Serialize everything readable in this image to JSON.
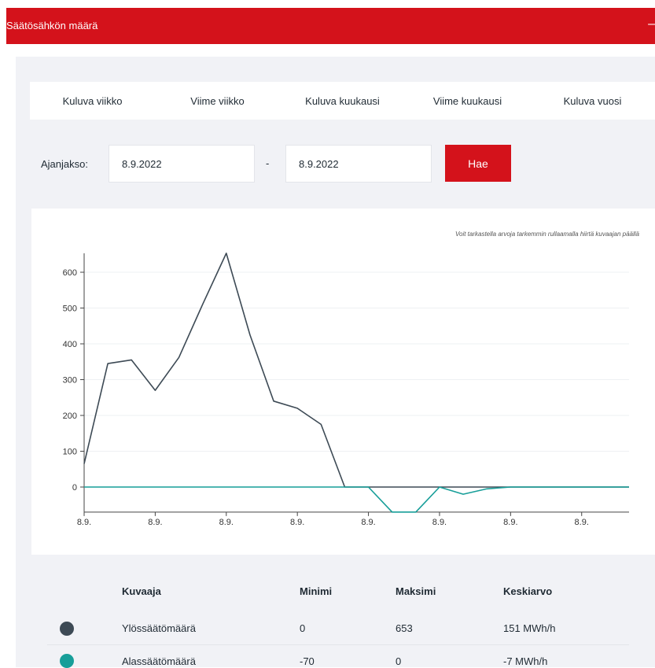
{
  "header": {
    "title": "Säätösähkön määrä",
    "collapse_symbol": "–"
  },
  "tabs": [
    "Kuluva viikko",
    "Viime viikko",
    "Kuluva kuukausi",
    "Viime kuukausi",
    "Kuluva vuosi"
  ],
  "period": {
    "label": "Ajanjakso:",
    "start": "8.9.2022",
    "separator": "-",
    "end": "8.9.2022",
    "search_label": "Hae"
  },
  "chart_hint": "Voit tarkastella arvoja tarkemmin rullaamalla hiirtä kuvaajan päällä",
  "colors": {
    "accent": "#d4121b",
    "up": "#3d4a55",
    "down": "#179e99"
  },
  "chart_data": {
    "type": "line",
    "x_tick_labels": [
      "8.9.",
      "8.9.",
      "8.9.",
      "8.9.",
      "8.9.",
      "8.9.",
      "8.9.",
      "8.9."
    ],
    "y_ticks": [
      0,
      100,
      200,
      300,
      400,
      500,
      600
    ],
    "ylim": [
      -70,
      653
    ],
    "x": [
      0,
      1,
      2,
      3,
      4,
      5,
      6,
      7,
      8,
      9,
      10,
      11,
      12,
      13,
      14,
      15,
      16,
      17,
      18,
      19,
      20,
      21,
      22,
      23
    ],
    "series": [
      {
        "name": "Ylössäätömäärä",
        "color": "#3d4a55",
        "values": [
          65,
          345,
          355,
          270,
          362,
          510,
          653,
          425,
          240,
          220,
          175,
          0,
          0,
          0,
          0,
          0,
          0,
          0,
          0,
          0,
          0,
          0,
          0,
          0
        ]
      },
      {
        "name": "Alassäätömäärä",
        "color": "#179e99",
        "values": [
          0,
          0,
          0,
          0,
          0,
          0,
          0,
          0,
          0,
          0,
          0,
          0,
          0,
          -70,
          -70,
          0,
          -20,
          -5,
          0,
          0,
          0,
          0,
          0,
          0
        ]
      }
    ]
  },
  "stats_table": {
    "headers": [
      "Kuvaaja",
      "Minimi",
      "Maksimi",
      "Keskiarvo"
    ],
    "rows": [
      {
        "name": "Ylössäätömäärä",
        "min": "0",
        "max": "653",
        "avg": "151 MWh/h",
        "color": "#3d4a55"
      },
      {
        "name": "Alassäätömäärä",
        "min": "-70",
        "max": "0",
        "avg": "-7 MWh/h",
        "color": "#179e99"
      }
    ]
  }
}
